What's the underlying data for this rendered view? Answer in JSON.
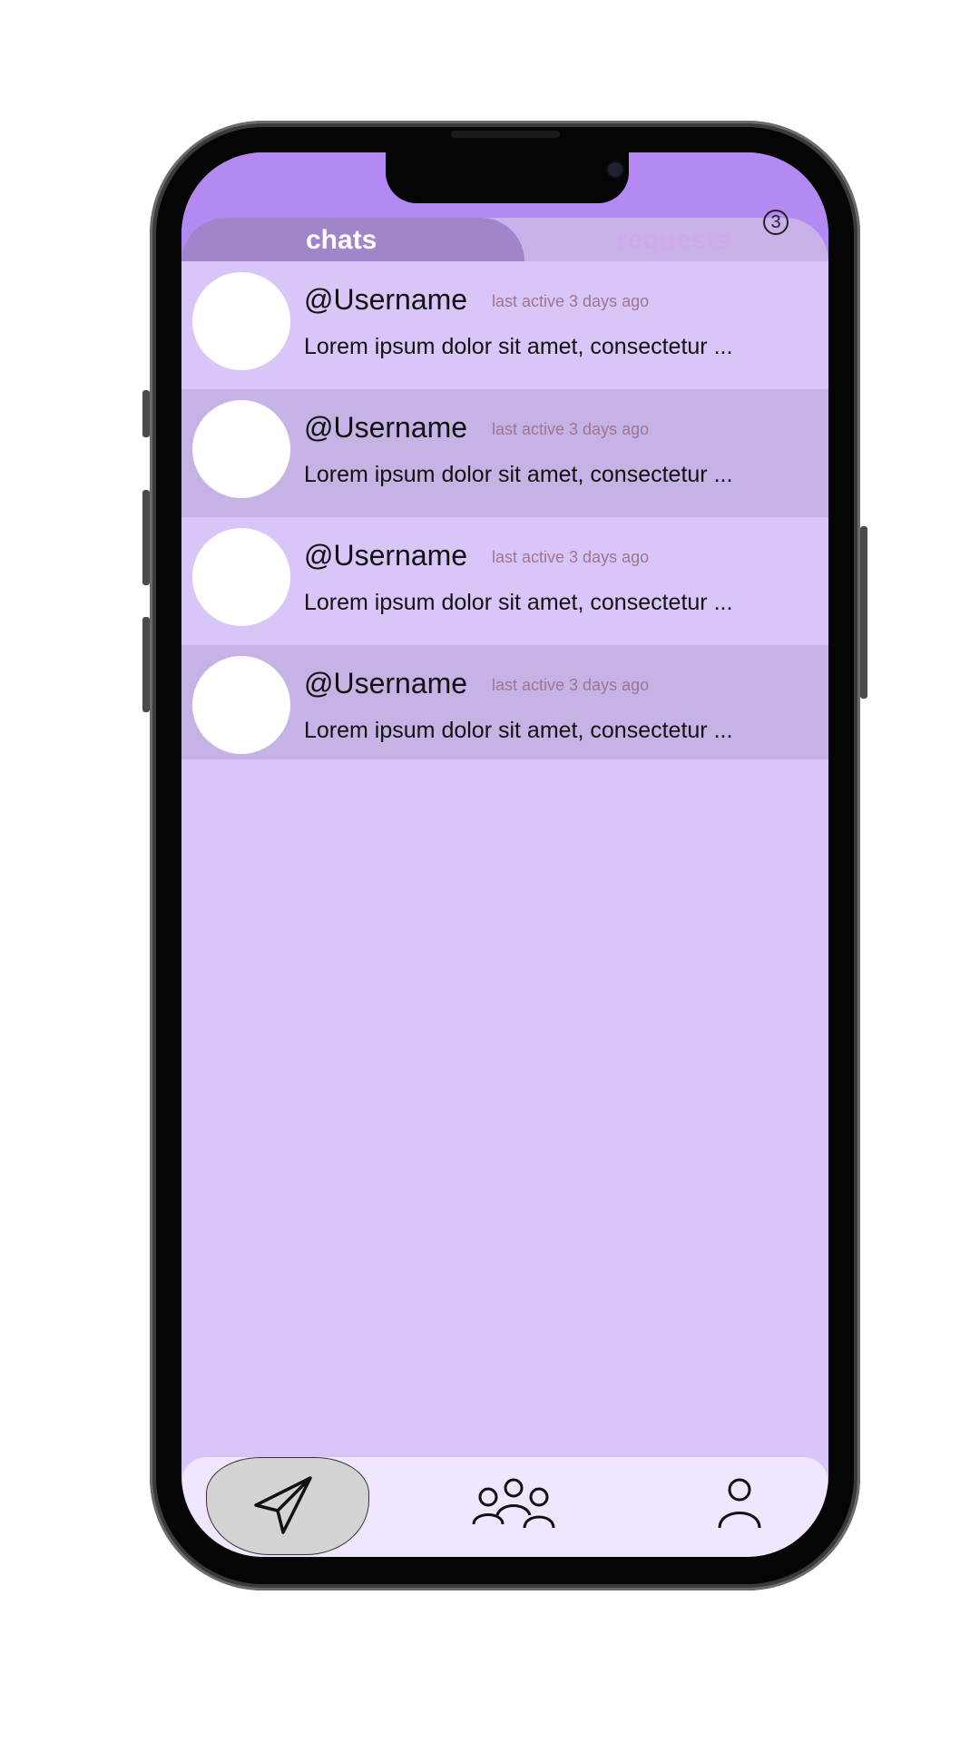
{
  "tabs": {
    "chats_label": "chats",
    "requests_label": "requests",
    "requests_badge": "3",
    "active": "chats"
  },
  "chats": [
    {
      "username": "@Username",
      "last_active": "last active 3 days ago",
      "preview": "Lorem ipsum dolor sit amet, consectetur ..."
    },
    {
      "username": "@Username",
      "last_active": "last active 3 days ago",
      "preview": "Lorem ipsum dolor sit amet, consectetur ..."
    },
    {
      "username": "@Username",
      "last_active": "last active 3 days ago",
      "preview": "Lorem ipsum dolor sit amet, consectetur ..."
    },
    {
      "username": "@Username",
      "last_active": "last active 3 days ago",
      "preview": "Lorem ipsum dolor sit amet, consectetur ..."
    }
  ],
  "bottom_nav": {
    "items": [
      {
        "icon": "send-icon",
        "selected": true
      },
      {
        "icon": "group-icon",
        "selected": false
      },
      {
        "icon": "profile-icon",
        "selected": false
      }
    ]
  },
  "colors": {
    "header": "#b489f4",
    "screen_bg": "#d9c6f8",
    "row_alt": "#c6b3e6",
    "tab_active": "#a085cb",
    "tab_inactive": "#c8b2e8",
    "nav_bg": "#f1e6ff"
  }
}
